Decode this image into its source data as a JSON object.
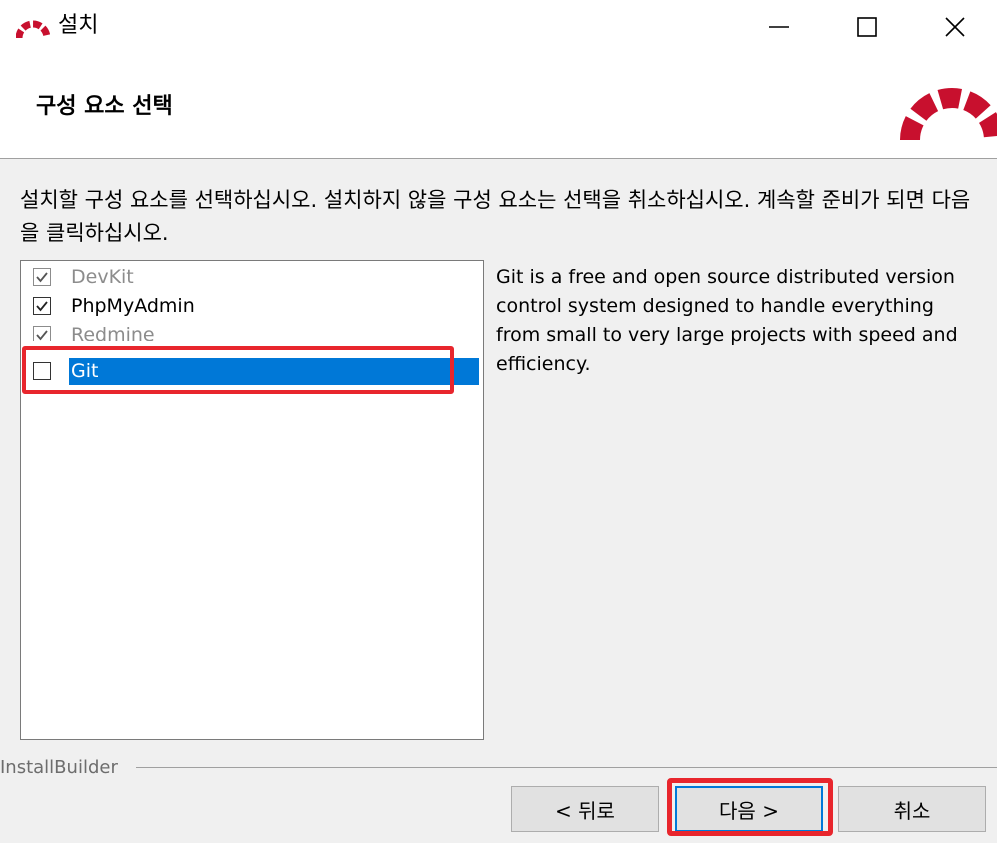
{
  "window": {
    "title": "설치",
    "minimize_icon": "minimize-icon",
    "maximize_icon": "maximize-icon",
    "close_icon": "close-icon"
  },
  "header": {
    "title": "구성 요소 선택",
    "logo_icon": "bitnami-arch-logo"
  },
  "instructions": "설치할 구성 요소를 선택하십시오. 설치하지 않을 구성 요소는 선택을 취소하십시오. 계속할 준비가 되면 다음을 클릭하십시오.",
  "components": [
    {
      "label": "DevKit",
      "checked": true,
      "enabled": false
    },
    {
      "label": "PhpMyAdmin",
      "checked": true,
      "enabled": true
    },
    {
      "label": "Redmine",
      "checked": true,
      "enabled": false
    },
    {
      "label": "Git",
      "checked": false,
      "enabled": true,
      "selected": true
    }
  ],
  "description": "Git is a free and open source distributed version control system designed to handle everything from small to very large projects with speed and efficiency.",
  "footer": {
    "brand": "InstallBuilder",
    "back_label": "< 뒤로",
    "next_label": "다음 >",
    "cancel_label": "취소"
  },
  "colors": {
    "accent": "#0078d7",
    "annotation": "#e8262d",
    "logo": "#c8102e"
  }
}
